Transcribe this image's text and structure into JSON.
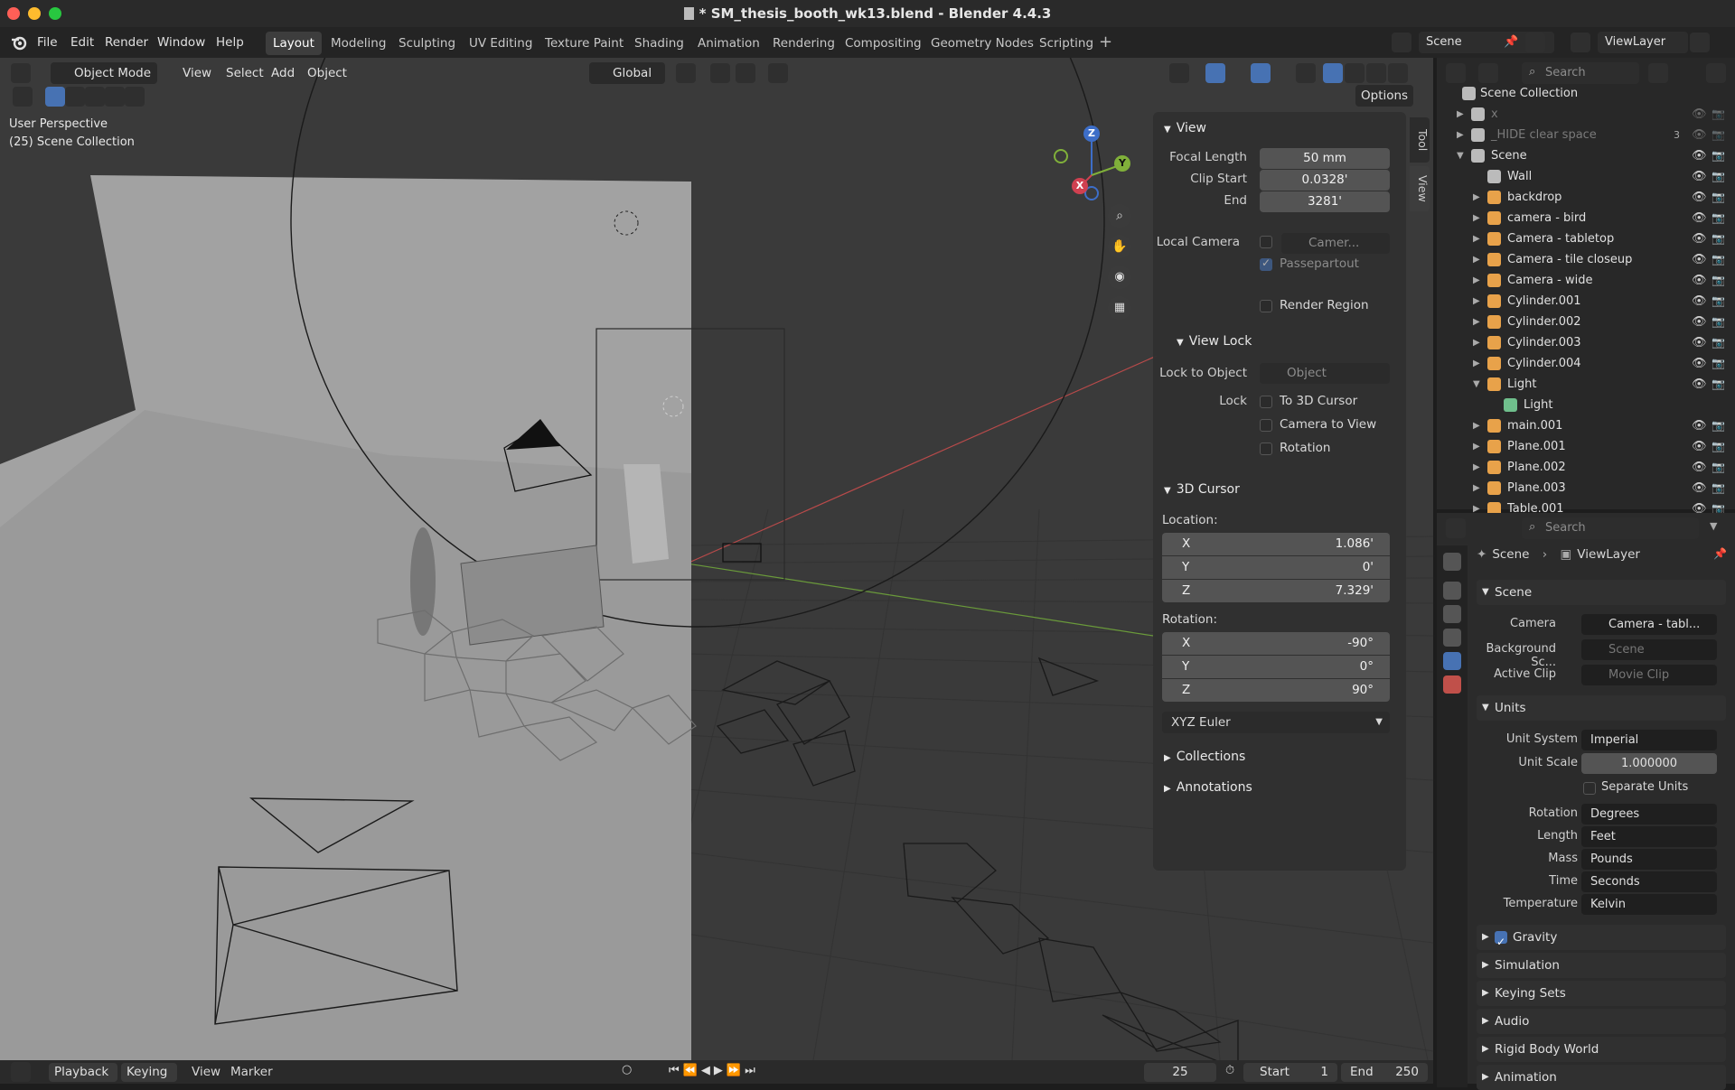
{
  "window": {
    "title": "* SM_thesis_booth_wk13.blend - Blender 4.4.3"
  },
  "menu": {
    "file": "File",
    "edit": "Edit",
    "render": "Render",
    "window": "Window",
    "help": "Help"
  },
  "workspaces": [
    "Layout",
    "Modeling",
    "Sculpting",
    "UV Editing",
    "Texture Paint",
    "Shading",
    "Animation",
    "Rendering",
    "Compositing",
    "Geometry Nodes",
    "Scripting"
  ],
  "scene_selector": {
    "scene": "Scene",
    "view_layer": "ViewLayer"
  },
  "viewport_header": {
    "mode": "Object Mode",
    "view": "View",
    "select": "Select",
    "add": "Add",
    "object": "Object",
    "orientation": "Global",
    "options": "Options"
  },
  "viewport_overlay": {
    "perspective": "User Perspective",
    "collection": "(25) Scene Collection"
  },
  "gizmo": {
    "z": "Z",
    "y": "Y",
    "x": "X"
  },
  "npanel": {
    "tabs": {
      "tool": "Tool",
      "view": "View"
    },
    "view": {
      "header": "View",
      "focal_length_label": "Focal Length",
      "focal_length": "50 mm",
      "clip_start_label": "Clip Start",
      "clip_start": "0.0328'",
      "end_label": "End",
      "end": "3281'",
      "local_camera_label": "Local Camera",
      "local_camera_value": "Camer...",
      "passepartout": "Passepartout",
      "render_region": "Render Region"
    },
    "view_lock": {
      "header": "View Lock",
      "lock_to_object_label": "Lock to Object",
      "lock_to_object_placeholder": "Object",
      "lock_label": "Lock",
      "to_3d_cursor": "To 3D Cursor",
      "camera_to_view": "Camera to View",
      "rotation": "Rotation"
    },
    "cursor": {
      "header": "3D Cursor",
      "location_label": "Location:",
      "loc_x_label": "X",
      "loc_x": "1.086'",
      "loc_y_label": "Y",
      "loc_y": "0'",
      "loc_z_label": "Z",
      "loc_z": "7.329'",
      "rotation_label": "Rotation:",
      "rot_x_label": "X",
      "rot_x": "-90°",
      "rot_y_label": "Y",
      "rot_y": "0°",
      "rot_z_label": "Z",
      "rot_z": "90°",
      "rotation_mode": "XYZ Euler"
    },
    "collections": "Collections",
    "annotations": "Annotations"
  },
  "outliner": {
    "search_placeholder": "Search",
    "root": "Scene Collection",
    "rows": [
      {
        "name": "x",
        "type": "collection",
        "dim": true
      },
      {
        "name": "_HIDE clear space",
        "type": "collection",
        "dim": true,
        "badge": "3"
      },
      {
        "name": "Scene",
        "type": "collection"
      },
      {
        "name": "Wall",
        "type": "collection"
      },
      {
        "name": "backdrop",
        "type": "mesh"
      },
      {
        "name": "camera - bird",
        "type": "camera"
      },
      {
        "name": "Camera - tabletop",
        "type": "camera"
      },
      {
        "name": "Camera - tile closeup",
        "type": "camera"
      },
      {
        "name": "Camera - wide",
        "type": "camera"
      },
      {
        "name": "Cylinder.001",
        "type": "mesh"
      },
      {
        "name": "Cylinder.002",
        "type": "mesh"
      },
      {
        "name": "Cylinder.003",
        "type": "mesh"
      },
      {
        "name": "Cylinder.004",
        "type": "mesh"
      },
      {
        "name": "Light",
        "type": "light"
      },
      {
        "name": "Light",
        "type": "light-data"
      },
      {
        "name": "main.001",
        "type": "mesh"
      },
      {
        "name": "Plane.001",
        "type": "mesh"
      },
      {
        "name": "Plane.002",
        "type": "mesh"
      },
      {
        "name": "Plane.003",
        "type": "mesh"
      },
      {
        "name": "Table.001",
        "type": "mesh"
      }
    ]
  },
  "properties": {
    "search_placeholder": "Search",
    "breadcrumb": {
      "scene": "Scene",
      "view_layer": "ViewLayer"
    },
    "scene_section": "Scene",
    "camera_label": "Camera",
    "camera_value": "Camera - tabl...",
    "background_label": "Background Sc...",
    "background_placeholder": "Scene",
    "active_clip_label": "Active Clip",
    "active_clip_placeholder": "Movie Clip",
    "units_section": "Units",
    "unit_system_label": "Unit System",
    "unit_system": "Imperial",
    "unit_scale_label": "Unit Scale",
    "unit_scale": "1.000000",
    "separate_units": "Separate Units",
    "rotation_label": "Rotation",
    "rotation": "Degrees",
    "length_label": "Length",
    "length": "Feet",
    "mass_label": "Mass",
    "mass": "Pounds",
    "time_label": "Time",
    "time": "Seconds",
    "temperature_label": "Temperature",
    "temperature": "Kelvin",
    "sections": [
      "Gravity",
      "Simulation",
      "Keying Sets",
      "Audio",
      "Rigid Body World",
      "Animation"
    ]
  },
  "timeline": {
    "playback": "Playback",
    "keying": "Keying",
    "view": "View",
    "marker": "Marker",
    "current_frame": "25",
    "start_label": "Start",
    "start": "1",
    "end_label": "End",
    "end": "250"
  }
}
